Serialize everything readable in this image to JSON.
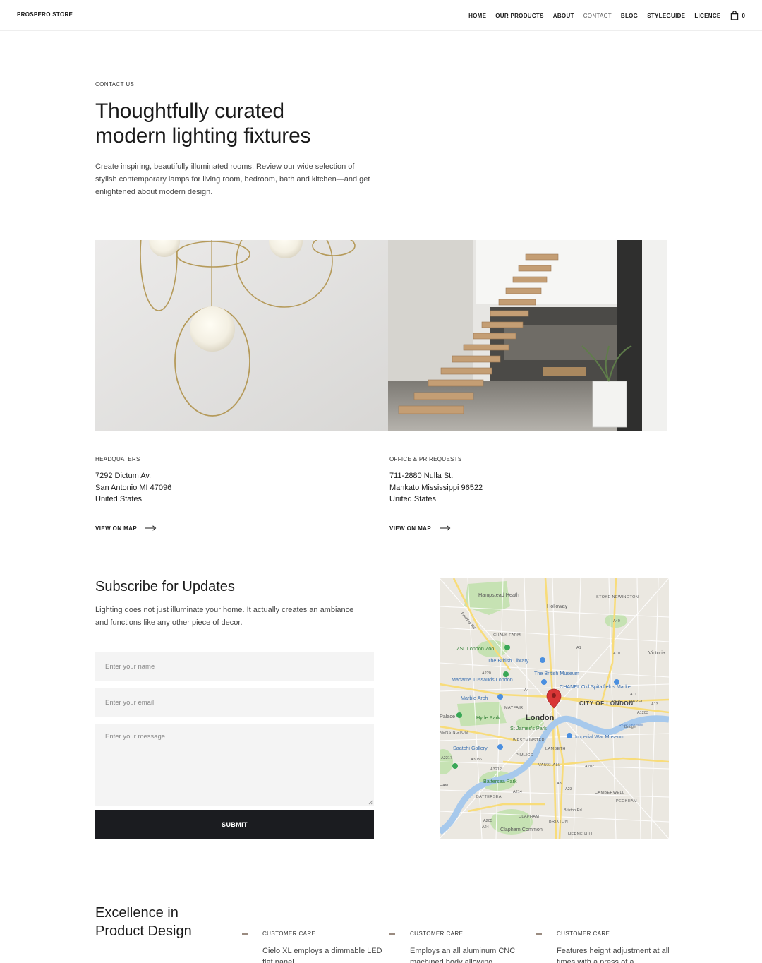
{
  "header": {
    "brand": "PROSPERO STORE",
    "nav": [
      "HOME",
      "OUR PRODUCTS",
      "ABOUT",
      "CONTACT",
      "BLOG",
      "STYLEGUIDE",
      "LICENCE"
    ],
    "active_nav": "CONTACT",
    "cart_count": "0"
  },
  "hero": {
    "eyebrow": "CONTACT US",
    "title_line1": "Thoughtfully curated",
    "title_line2": "modern lighting fixtures",
    "lead": "Create inspiring, beautifully illuminated rooms. Review our wide selection of stylish contemporary lamps for living room, bedroom, bath and kitchen—and get enlightened about modern design."
  },
  "locations": [
    {
      "label": "HEADQUATERS",
      "lines": [
        "7292 Dictum Av.",
        "San Antonio MI 47096",
        "United States"
      ],
      "link": "VIEW ON MAP"
    },
    {
      "label": "OFFICE & PR REQUESTS",
      "lines": [
        "711-2880 Nulla St.",
        "Mankato Mississippi 96522",
        "United States"
      ],
      "link": "VIEW ON MAP"
    }
  ],
  "subscribe": {
    "title": "Subscribe for Updates",
    "description": "Lighting does not just illuminate your home. It actually creates an ambiance and functions like any other piece of decor.",
    "name_placeholder": "Enter your name",
    "email_placeholder": "Enter your email",
    "message_placeholder": "Enter your message",
    "submit_label": "SUBMIT"
  },
  "map": {
    "labels": [
      "Hampstead Heath",
      "Holloway",
      "STOKE NEWINGTON",
      "CHALK FARM",
      "ZSL London Zoo",
      "The British Library",
      "Madame Tussauds London",
      "The British Museum",
      "CHANEL Old Spitalfields Market",
      "Marble Arch",
      "MAYFAIR",
      "CITY OF LONDON",
      "WHITECHAPEL",
      "Hyde Park",
      "London",
      "St James's Park",
      "Imperial War Museum",
      "WESTMINSTER",
      "Saatchi Gallery",
      "LAMBETH",
      "PIMLICO",
      "VAUXHALL",
      "Battersea Park",
      "CAMBERWELL",
      "PECKHAM",
      "BATTERSEA",
      "CLAPHAM",
      "BRIXTON",
      "Clapham Common",
      "HERNE HILL",
      "Victoria",
      "Finchley Rd",
      "A1",
      "A10",
      "A11",
      "A13",
      "A1203",
      "A202",
      "A3212",
      "A3036",
      "A205",
      "A3",
      "A23",
      "A2217",
      "A220",
      "A214",
      "A24",
      "A4",
      "A40",
      "Brixton Rd",
      "KENSINGTON",
      "Palace",
      "Bridge",
      "HAM",
      "River Thames"
    ]
  },
  "excellence": {
    "title_line1": "Excellence in",
    "title_line2": "Product Design",
    "features": [
      {
        "label": "CUSTOMER CARE",
        "text": "Cielo XL employs a dimmable LED flat panel"
      },
      {
        "label": "CUSTOMER CARE",
        "text": "Employs an all aluminum CNC machined body allowing"
      },
      {
        "label": "CUSTOMER CARE",
        "text": "Features height adjustment at all times with a press of a"
      }
    ]
  },
  "colors": {
    "accent_dark": "#1b1c20",
    "field_bg": "#f4f4f4",
    "pin": "#d93636",
    "feature_dash": "#9a8b80"
  }
}
